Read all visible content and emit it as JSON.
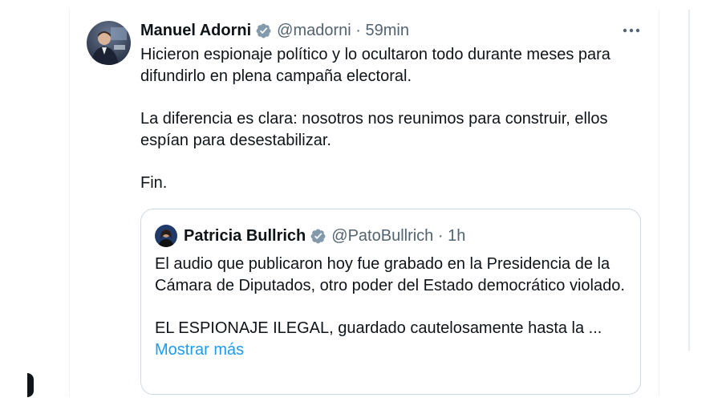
{
  "tweet": {
    "author": {
      "name": "Manuel Adorni",
      "handle_time": "@madorni · 59min",
      "avatar_icon": "user-avatar"
    },
    "more_icon": "more-options-icon",
    "verified_icon": "verified-badge-icon",
    "paragraphs": [
      "Hicieron espionaje político y lo ocultaron todo durante meses para difundirlo en plena campaña electoral.",
      "La diferencia es clara: nosotros nos reunimos para construir, ellos espían para desestabilizar.",
      "Fin."
    ]
  },
  "quote": {
    "author": {
      "name": "Patricia Bullrich",
      "handle_time": "@PatoBullrich · 1h"
    },
    "paragraphs": [
      "El audio que publicaron hoy fue grabado en la Presidencia de la Cámara de Diputados, otro poder del Estado democrático violado.",
      "EL ESPIONAJE ILEGAL, guardado cautelosamente hasta la ..."
    ],
    "show_more_label": "Mostrar más"
  },
  "colors": {
    "text": "#0f1419",
    "secondary": "#536471",
    "link": "#1d9bf0",
    "border": "#cfd9de",
    "verified_badge": "#829aab"
  }
}
